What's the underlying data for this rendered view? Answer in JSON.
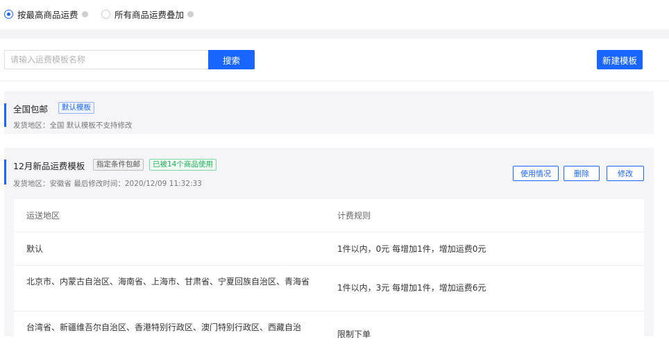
{
  "shipping_mode": {
    "options": [
      {
        "label": "按最高商品运费",
        "selected": true
      },
      {
        "label": "所有商品运费叠加",
        "selected": false
      }
    ]
  },
  "search": {
    "placeholder": "请输入运费模板名称",
    "button_label": "搜索"
  },
  "new_template_label": "新建模板",
  "templates": [
    {
      "name": "全国包邮",
      "tags": [
        "默认模板"
      ],
      "meta": "发货地区：全国    默认模板不支持修改"
    },
    {
      "name": "12月新品运费模板",
      "tags": [
        "指定条件包邮",
        "已被14个商品使用"
      ],
      "meta": "发货地区：安徽省    最后修改时间：2020/12/09 11:32:33",
      "actions": [
        "使用情况",
        "删除",
        "修改"
      ],
      "table": {
        "headers": [
          "运送地区",
          "计费规则"
        ],
        "rows": [
          {
            "region": "默认",
            "rule": "1件以内，0元    每增加1件，增加运费0元"
          },
          {
            "region": "北京市、内蒙古自治区、海南省、上海市、甘肃省、宁夏回族自治区、青海省",
            "rule": "1件以内，3元    每增加1件，增加运费6元"
          },
          {
            "region": "台湾省、新疆维吾尔自治区、香港特别行政区、澳门特别行政区、西藏自治",
            "rule": "限制下单"
          }
        ]
      }
    }
  ],
  "colors": {
    "primary": "#1966ff",
    "green_tag": "#1fb25a",
    "card_bg": "#f5f5f7"
  }
}
